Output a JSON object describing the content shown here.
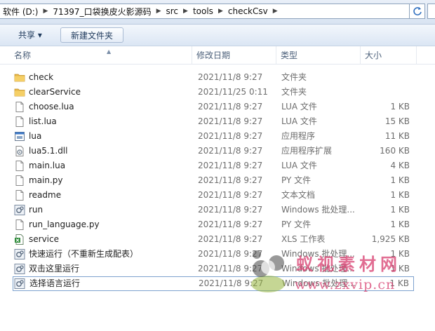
{
  "address": {
    "crumbs": [
      "软件 (D:)",
      "71397_口袋换皮火影源码",
      "src",
      "tools",
      "checkCsv"
    ]
  },
  "toolbar": {
    "share_label": "共享 ▾",
    "new_folder_label": "新建文件夹"
  },
  "columns": {
    "name": "名称",
    "date": "修改日期",
    "type": "类型",
    "size": "大小"
  },
  "files": [
    {
      "name": "check",
      "date": "2021/11/8 9:27",
      "type": "文件夹",
      "size": "",
      "icon": "folder-icon"
    },
    {
      "name": "clearService",
      "date": "2021/11/25 0:11",
      "type": "文件夹",
      "size": "",
      "icon": "folder-icon"
    },
    {
      "name": "choose.lua",
      "date": "2021/11/8 9:27",
      "type": "LUA 文件",
      "size": "1 KB",
      "icon": "document-icon"
    },
    {
      "name": "list.lua",
      "date": "2021/11/8 9:27",
      "type": "LUA 文件",
      "size": "15 KB",
      "icon": "document-icon"
    },
    {
      "name": "lua",
      "date": "2021/11/8 9:27",
      "type": "应用程序",
      "size": "11 KB",
      "icon": "application-icon"
    },
    {
      "name": "lua5.1.dll",
      "date": "2021/11/8 9:27",
      "type": "应用程序扩展",
      "size": "160 KB",
      "icon": "dll-icon"
    },
    {
      "name": "main.lua",
      "date": "2021/11/8 9:27",
      "type": "LUA 文件",
      "size": "4 KB",
      "icon": "document-icon"
    },
    {
      "name": "main.py",
      "date": "2021/11/8 9:27",
      "type": "PY 文件",
      "size": "1 KB",
      "icon": "document-icon"
    },
    {
      "name": "readme",
      "date": "2021/11/8 9:27",
      "type": "文本文档",
      "size": "1 KB",
      "icon": "document-icon"
    },
    {
      "name": "run",
      "date": "2021/11/8 9:27",
      "type": "Windows 批处理...",
      "size": "1 KB",
      "icon": "batch-file-icon"
    },
    {
      "name": "run_language.py",
      "date": "2021/11/8 9:27",
      "type": "PY 文件",
      "size": "1 KB",
      "icon": "document-icon"
    },
    {
      "name": "service",
      "date": "2021/11/8 9:27",
      "type": "XLS 工作表",
      "size": "1,925 KB",
      "icon": "spreadsheet-icon"
    },
    {
      "name": "快速运行（不重新生成配表）",
      "date": "2021/11/8 9:27",
      "type": "Windows 批处理...",
      "size": "1 KB",
      "icon": "batch-file-icon"
    },
    {
      "name": "双击这里运行",
      "date": "2021/11/8 9:27",
      "type": "Windows 批处理...",
      "size": "1 KB",
      "icon": "batch-file-icon"
    },
    {
      "name": "选择语言运行",
      "date": "2021/11/8 9:27",
      "type": "Windows 批处理...",
      "size": "1 KB",
      "icon": "batch-file-icon"
    }
  ],
  "watermark": {
    "line1": "蚁视素材网",
    "line2": "www.zxvip.cn"
  },
  "colors": {
    "folder": "#e8b84a",
    "selection_border": "#7da2ce",
    "column_header_text": "#4c607a",
    "watermark": "#d73c6e"
  }
}
